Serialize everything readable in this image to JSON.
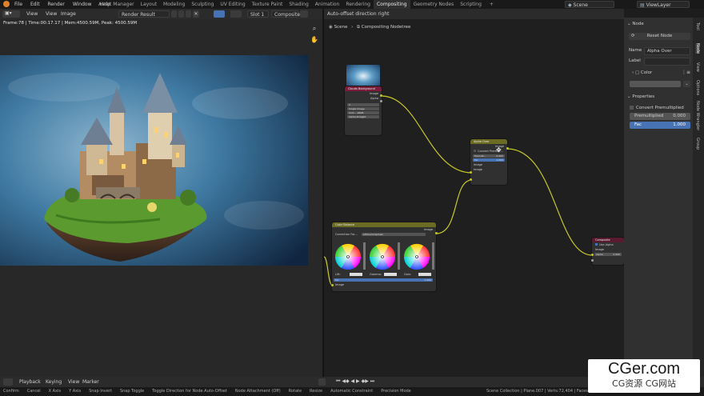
{
  "menu": [
    "File",
    "Edit",
    "Render",
    "Window",
    "Help"
  ],
  "workspaces": [
    "Asset Manager",
    "Layout",
    "Modeling",
    "Sculpting",
    "UV Editing",
    "Texture Paint",
    "Shading",
    "Animation",
    "Rendering",
    "Compositing",
    "Geometry Nodes",
    "Scripting"
  ],
  "active_workspace": "Compositing",
  "scene_name": "Scene",
  "view_layer": "ViewLayer",
  "image_editor": {
    "menu_view": "View",
    "menu_view2": "View",
    "menu_image": "Image",
    "render_result": "Render Result",
    "slot": "Slot 1",
    "pass": "Composite",
    "stats": "Frame:78 | Time:00:17.17 | Mem:4500.59M, Peak: 4500.59M"
  },
  "node_editor": {
    "header_text": "Auto-offset direction right",
    "breadcrumb_scene": "Scene",
    "breadcrumb_tree": "Compositing Nodetree"
  },
  "nodes": {
    "image": {
      "title": "Clouds Background",
      "out_image": "Image",
      "out_alpha": "Alpha",
      "count": "2",
      "source": "Single Image",
      "color_label": "Colo...",
      "color_value": "sRGB",
      "alpha_label": "Alpha",
      "alpha_value": "Straight"
    },
    "alpha_over": {
      "title": "Alpha Over",
      "out": "Image",
      "convert": "Convert Premult...",
      "premul": "Premult...",
      "premul_value": "0.000",
      "fac": "Fac",
      "fac_value": "1.000",
      "in1": "Image",
      "in2": "Image"
    },
    "color_balance": {
      "title": "Color Balance",
      "out": "Image",
      "correction": "Correction For...",
      "mode": "Lift/Gamma/Gain",
      "lift": "Lift:",
      "gamma": "Gamma:",
      "gain": "Gain:",
      "fac": "Fac",
      "fac_value": "1.000",
      "in": "Image"
    },
    "composite": {
      "title": "Composite",
      "use_alpha": "Use Alpha",
      "image": "Image",
      "alpha": "Alpha",
      "alpha_value": "1.000"
    }
  },
  "sidebar": {
    "panel_node": "Node",
    "reset": "Reset Node",
    "name_label": "Name",
    "name_value": "Alpha Over",
    "label_label": "Label",
    "color_label": "Color",
    "properties": "Properties",
    "convert": "Convert Premultiplied",
    "premul_label": "Premultiplied",
    "premul_value": "0.000",
    "fac_label": "Fac",
    "fac_value": "1.000",
    "tabs": [
      "Tool",
      "Node",
      "View",
      "Options",
      "Node Wrangler",
      "Group"
    ]
  },
  "timeline": {
    "playback": "Playback",
    "keying": "Keying",
    "view": "View",
    "marker": "Marker"
  },
  "status": {
    "items": [
      "Confirm",
      "Cancel",
      "X Axis",
      "Y Axis",
      "Snap Invert",
      "Snap Toggle",
      "Toggle Direction for Node Auto-Offset",
      "Node Attachment (Off)",
      "Rotate",
      "Resize",
      "Automatic Constraint",
      "Precision Mode"
    ],
    "right": "Scene Collection | Plane.007 | Verts:72,404 | Faces:5..."
  },
  "watermark": {
    "main": "CGer.com",
    "sub": "CG资源  CG网站"
  },
  "colors": {
    "accent_blue": "#4772b3",
    "socket_yellow": "#c7c729",
    "image_node_header": "#7a1d3a",
    "color_node_header": "#6b6b24",
    "output_node_header": "#5a1a30",
    "sky_top": "#10253f",
    "sky_mid": "#3b6f96"
  }
}
